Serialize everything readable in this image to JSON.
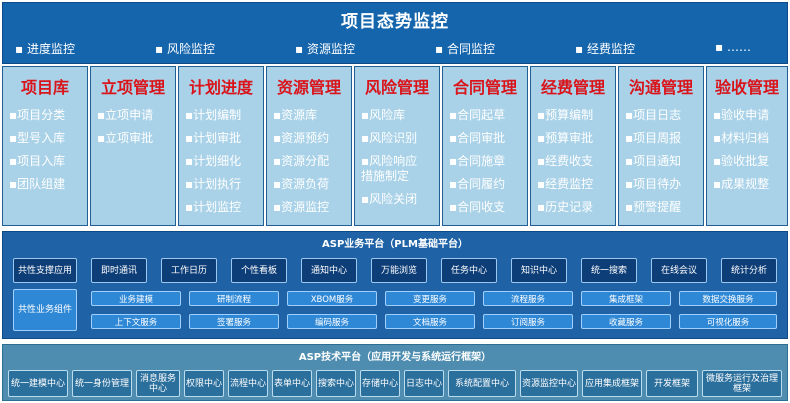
{
  "header": {
    "title": "项目态势监控",
    "subnav": [
      "▪  进度监控",
      "▪  风险监控",
      "▪  资源监控",
      "▪  合同监控",
      "▪  经费监控",
      "▪  ……"
    ]
  },
  "modules": [
    {
      "title": "项目库",
      "items": [
        "▪项目分类",
        "▪型号入库",
        "▪项目入库",
        "▪团队组建"
      ]
    },
    {
      "title": "立项管理",
      "items": [
        "▪立项申请",
        "▪立项审批"
      ]
    },
    {
      "title": "计划进度",
      "items": [
        "▪计划编制",
        "▪计划审批",
        "▪计划细化",
        "▪计划执行",
        "▪计划监控"
      ]
    },
    {
      "title": "资源管理",
      "items": [
        "▪资源库",
        "▪资源预约",
        "▪资源分配",
        "▪资源负荷",
        "▪资源监控"
      ]
    },
    {
      "title": "风险管理",
      "items": [
        "▪风险库",
        "▪风险识别",
        "▪风险响应措施制定",
        "▪风险关闭"
      ]
    },
    {
      "title": "合同管理",
      "items": [
        "▪合同起草",
        "▪合同审批",
        "▪合同施章",
        "▪合同履约",
        "▪合同收支"
      ]
    },
    {
      "title": "经费管理",
      "items": [
        "▪预算编制",
        "▪预算审批",
        "▪经费收支",
        "▪经费监控",
        "▪历史记录"
      ]
    },
    {
      "title": "沟通管理",
      "items": [
        "▪项目日志",
        "▪项目周报",
        "▪项目通知",
        "▪项目待办",
        "▪预警提醒"
      ]
    },
    {
      "title": "验收管理",
      "items": [
        "▪验收申请",
        "▪材料归档",
        "▪验收批复",
        "▪成果规整"
      ]
    }
  ],
  "business_platform": {
    "title": "ASP业务平台（PLM基础平台）",
    "apps": [
      "共性支撑应用",
      "即时通讯",
      "工作日历",
      "个性看板",
      "通知中心",
      "万能浏览",
      "任务中心",
      "知识中心",
      "统一搜索",
      "在线会议",
      "统计分析"
    ],
    "group_label": "共性业务组件",
    "services_row1": [
      "业务建模",
      "研制流程",
      "XBOM服务",
      "变更服务",
      "流程服务",
      "集成框架",
      "数据交换服务"
    ],
    "services_row2": [
      "上下文服务",
      "签署服务",
      "编码服务",
      "文档服务",
      "订阅服务",
      "收藏服务",
      "可视化服务"
    ]
  },
  "tech_platform": {
    "title": "ASP技术平台（应用开发与系统运行框架）",
    "items": [
      "统一建模中心",
      "统一身份管理",
      "消息服务中心",
      "权限中心",
      "流程中心",
      "表单中心",
      "搜索中心",
      "存储中心",
      "日志中心",
      "系统配置中心",
      "资源监控中心",
      "应用集成框架",
      "开发框架",
      "微服务运行及治理框架"
    ]
  }
}
